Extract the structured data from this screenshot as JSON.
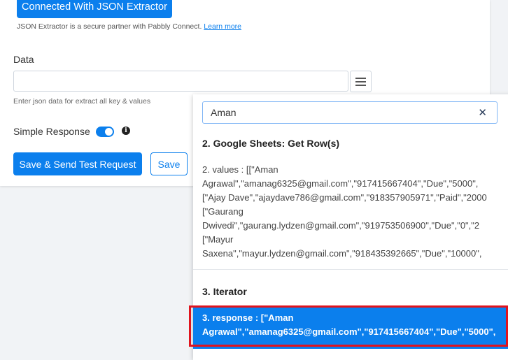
{
  "connection": {
    "button_label": "Connected With JSON Extractor",
    "partner_text": "JSON Extractor is a secure partner with Pabbly Connect.",
    "learn_more": "Learn more"
  },
  "form": {
    "data_label": "Data",
    "data_value": "",
    "hint": "Enter json data for extract all key & values",
    "simple_response_label": "Simple Response",
    "simple_response_on": true,
    "save_send_label": "Save & Send Test Request",
    "save_label": "Save"
  },
  "dropdown": {
    "search_value": "Aman",
    "groups": [
      {
        "title": "2. Google Sheets: Get Row(s)",
        "items": [
          {
            "lines": [
              "2. values : [[\"Aman",
              "Agrawal\",\"amanag6325@gmail.com\",\"917415667404\",\"Due\",\"5000\",",
              "[\"Ajay Dave\",\"ajaydave786@gmail.com\",\"918357905971\",\"Paid\",\"2000",
              "[\"Gaurang",
              "Dwivedi\",\"gaurang.lydzen@gmail.com\",\"919753506900\",\"Due\",\"0\",\"2",
              "[\"Mayur",
              "Saxena\",\"mayur.lydzen@gmail.com\",\"918435392665\",\"Due\",\"10000\","
            ]
          }
        ]
      },
      {
        "title": "3. Iterator",
        "items": [
          {
            "lines": [
              "3. response : [\"Aman",
              "Agrawal\",\"amanag6325@gmail.com\",\"917415667404\",\"Due\",\"5000\","
            ],
            "selected": true
          }
        ]
      }
    ]
  },
  "colors": {
    "accent": "#0b7fed",
    "highlight_border": "#e0141e"
  }
}
